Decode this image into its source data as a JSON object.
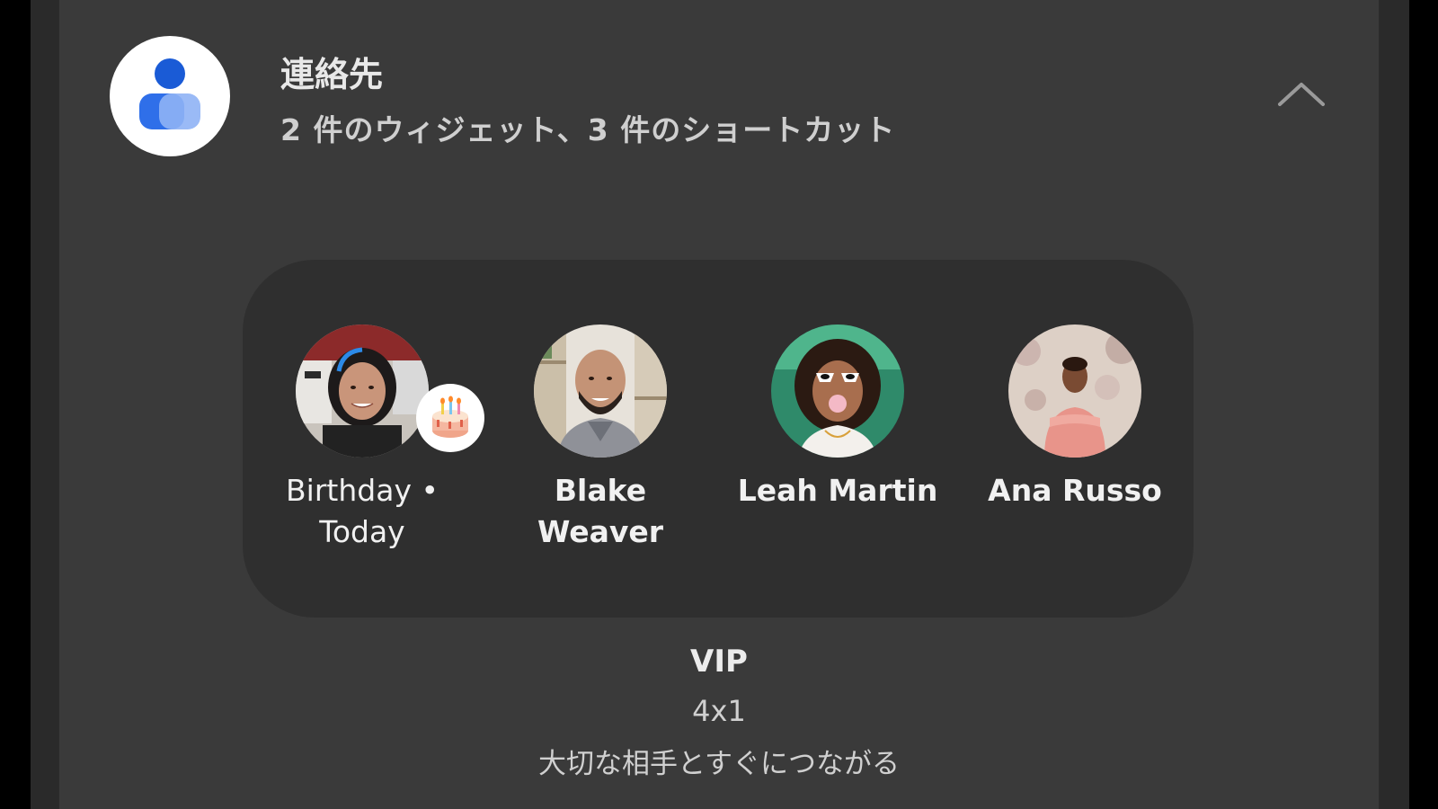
{
  "app": {
    "icon": "contacts-app-icon",
    "title": "連絡先",
    "subtitle": "2 件のウィジェット、3 件のショートカット",
    "collapse_icon": "chevron-up-icon"
  },
  "widget": {
    "contacts": [
      {
        "name": "Birthday • Today",
        "badge_icon": "birthday-cake-icon"
      },
      {
        "name": "Blake Weaver"
      },
      {
        "name": "Leah Martin"
      },
      {
        "name": "Ana Russo"
      }
    ],
    "name": "VIP",
    "size": "4x1",
    "description": "大切な相手とすぐにつながる"
  },
  "colors": {
    "background": "#000000",
    "panel": "#3a3a3a",
    "widget_card": "#2f2f2f",
    "contacts_blue": "#1a5bd6"
  }
}
